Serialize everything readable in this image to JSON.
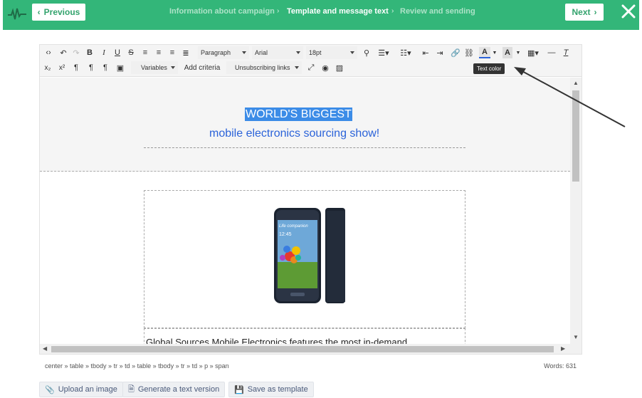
{
  "colors": {
    "brand": "#33b679",
    "selection": "#3c8ce7",
    "link_blue": "#2b63d9"
  },
  "header": {
    "logo_icon": "pulse-icon",
    "previous_label": "Previous",
    "next_label": "Next",
    "steps": [
      "Information about campaign",
      "Template and message text",
      "Review and sending"
    ],
    "active_step": 1,
    "close_icon": "close-icon"
  },
  "toolbar": {
    "paragraph": "Paragraph",
    "font": "Arial",
    "size": "18pt",
    "variables": "Variables",
    "add_criteria": "Add criteria",
    "unsubscribing": "Unsubscribing links",
    "tooltip": "Text color"
  },
  "content": {
    "headline": "WORLD'S BIGGEST",
    "subheadline": "mobile electronics sourcing show!",
    "body_text": "Global Sources Mobile Electronics features the most in-demand",
    "phone_screen_text": "Life companion",
    "phone_time": "12:45"
  },
  "status": {
    "path": "center » table » tbody » tr » td » table » tbody » tr » td » p » span",
    "words": "Words: 631"
  },
  "actions": {
    "upload": "Upload an image",
    "generate": "Generate a text version",
    "save": "Save as template"
  }
}
